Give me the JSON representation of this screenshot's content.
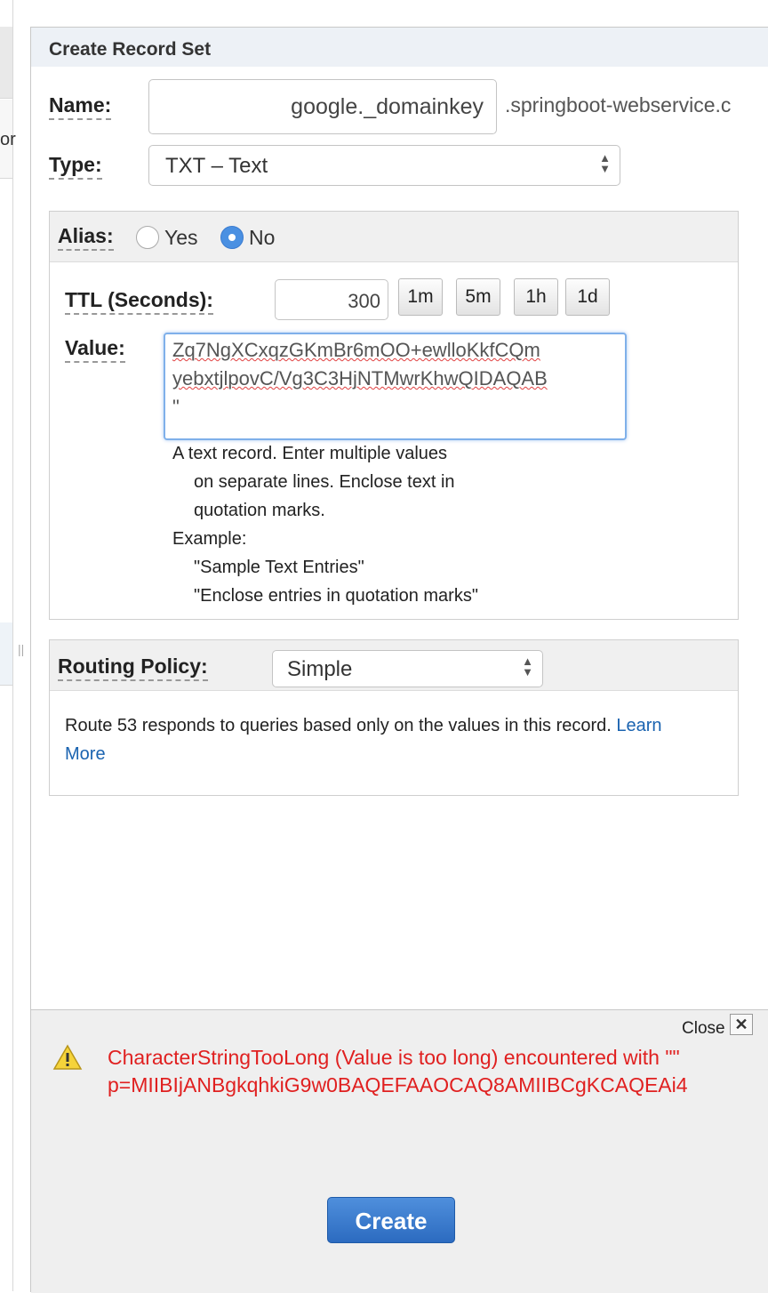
{
  "panel": {
    "title": "Create Record Set"
  },
  "name": {
    "label": "Name:",
    "value": "google._domainkey",
    "suffix": ".springboot-webservice.c"
  },
  "type": {
    "label": "Type:",
    "selected": "TXT – Text"
  },
  "alias": {
    "label": "Alias:",
    "yes": "Yes",
    "no": "No",
    "selected": "No"
  },
  "ttl": {
    "label": "TTL (Seconds):",
    "value": "300",
    "buttons": [
      "1m",
      "5m",
      "1h",
      "1d"
    ]
  },
  "value": {
    "label": "Value:",
    "lines": [
      "Zq7NgXCxqzGKmBr6mOO+ewlloKkfCQm",
      "yebxtjlpovC/Vg3C3HjNTMwrKhwQIDAQAB",
      "\""
    ],
    "help": {
      "line1": "A text record. Enter multiple values",
      "line2": "on separate lines. Enclose text in",
      "line3": "quotation marks.",
      "example_label": "Example:",
      "example1": "\"Sample Text Entries\"",
      "example2": "\"Enclose entries in quotation marks\""
    }
  },
  "routing": {
    "label": "Routing Policy:",
    "selected": "Simple",
    "description": "Route 53 responds to queries based only on the values in this record.",
    "link1": "Learn",
    "link2": "More"
  },
  "error": {
    "close_label": "Close",
    "close_icon": "✕",
    "line1": "CharacterStringTooLong (Value is too long) encountered with \"\"",
    "line2": "p=MIIBIjANBgkqhkiG9w0BAQEFAAOCAQ8AMIIBCgKCAQEAi4"
  },
  "create_button": "Create",
  "left": {
    "fragment": "or",
    "splitter": "||"
  },
  "colors": {
    "error": "#e02020",
    "accent": "#2c6bc0",
    "link": "#1a63b0"
  }
}
